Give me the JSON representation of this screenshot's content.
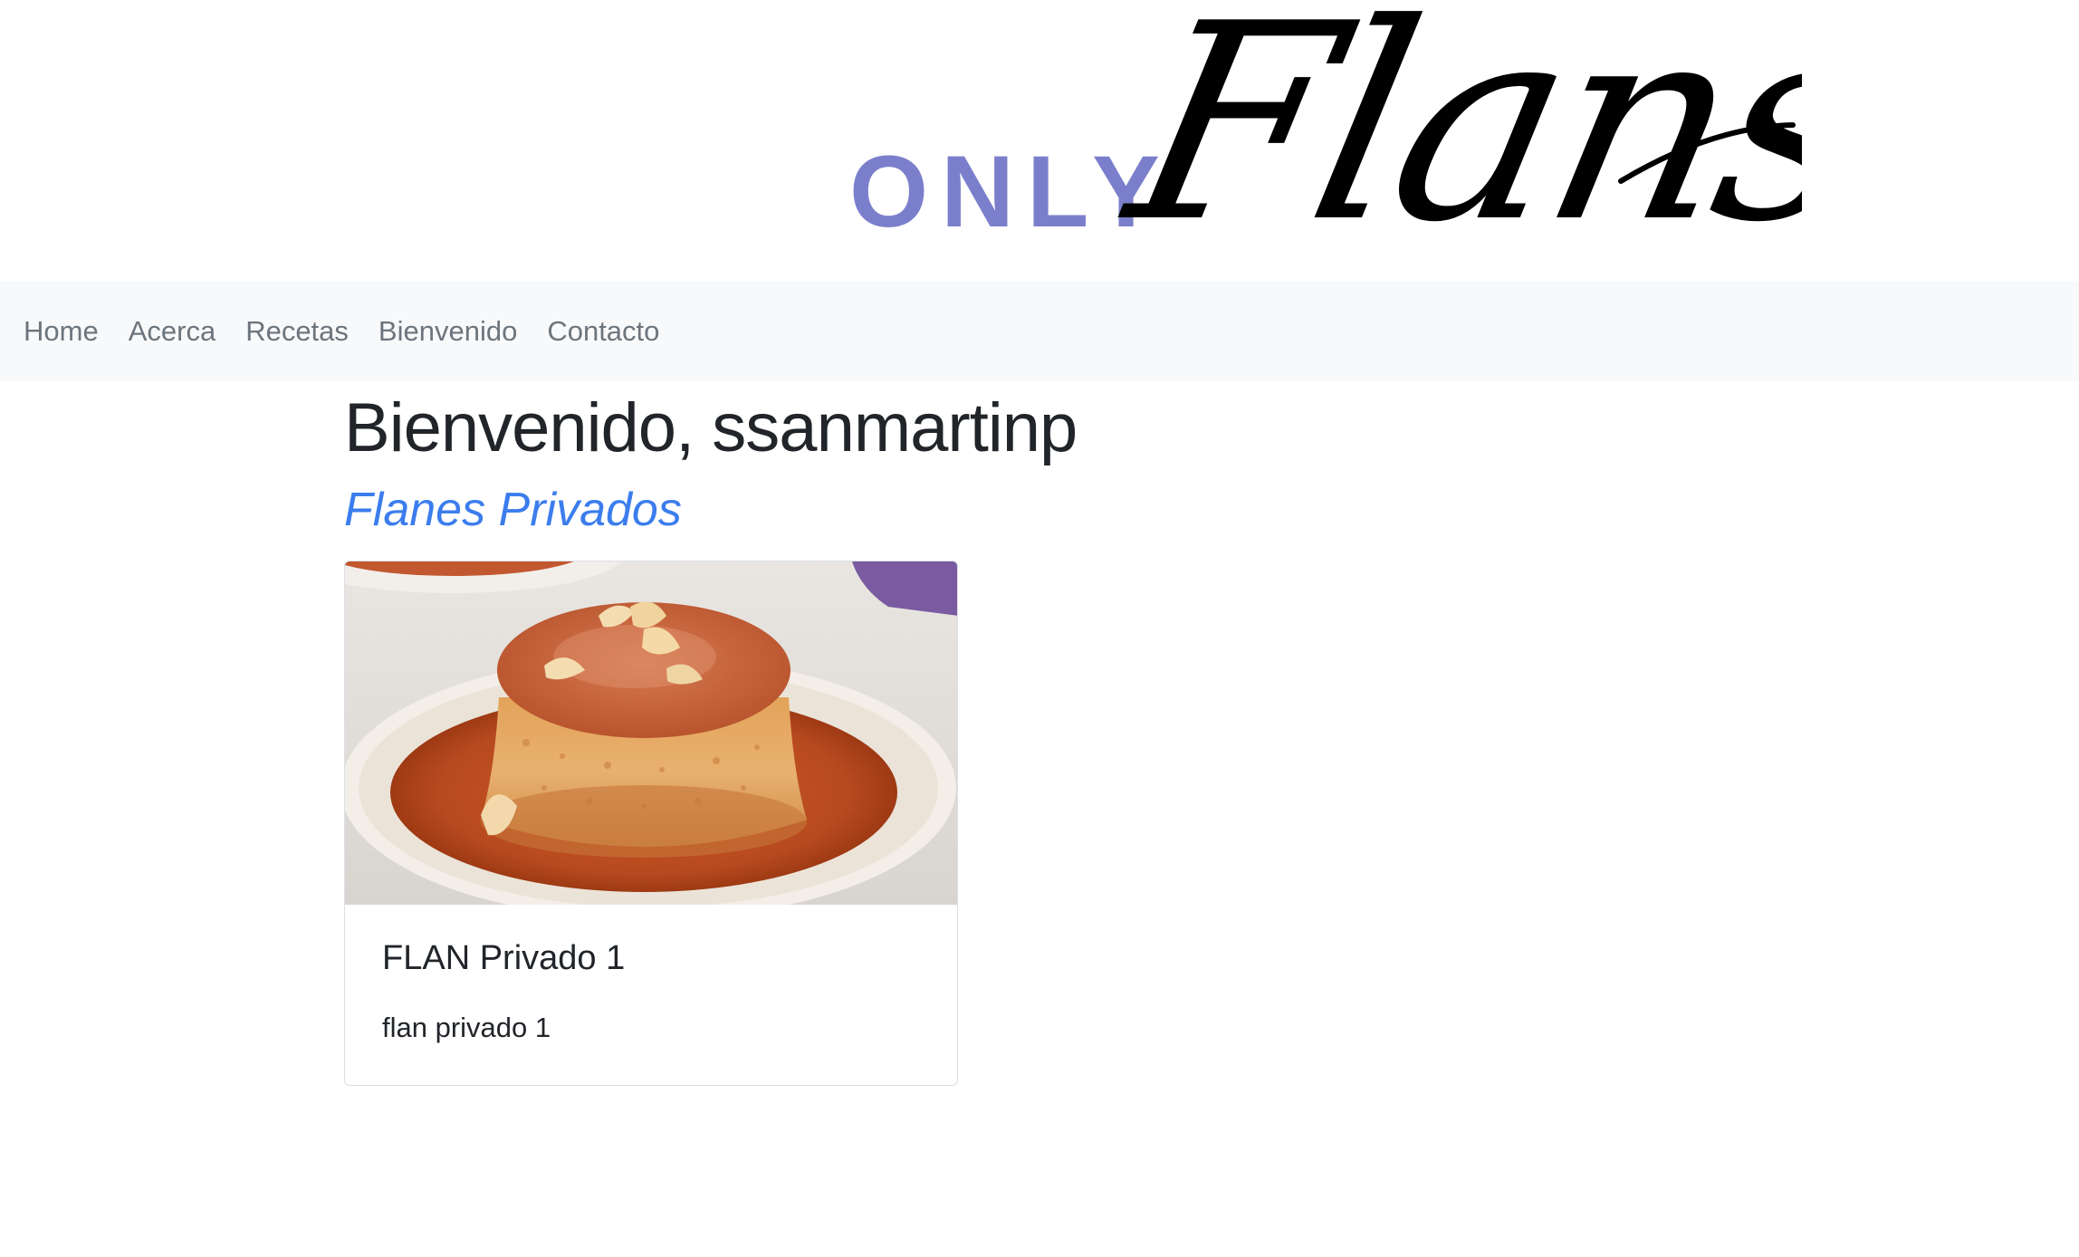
{
  "logo": {
    "prefix": "ONLY",
    "script": "Flans",
    "prefix_color": "#7b7fcb",
    "script_color": "#000000"
  },
  "navbar": {
    "items": [
      {
        "label": "Home"
      },
      {
        "label": "Acerca"
      },
      {
        "label": "Recetas"
      },
      {
        "label": "Bienvenido"
      },
      {
        "label": "Contacto"
      }
    ]
  },
  "main": {
    "welcome": "Bienvenido, ssanmartinp",
    "section_title": "Flanes Privados",
    "cards": [
      {
        "image": "flan-photo",
        "title": "FLAN Privado 1",
        "text": "flan privado 1"
      }
    ]
  },
  "colors": {
    "nav_background": "#f8f9fa",
    "nav_text": "#6c757d",
    "heading": "#212529",
    "section_title": "#3b7ded"
  }
}
